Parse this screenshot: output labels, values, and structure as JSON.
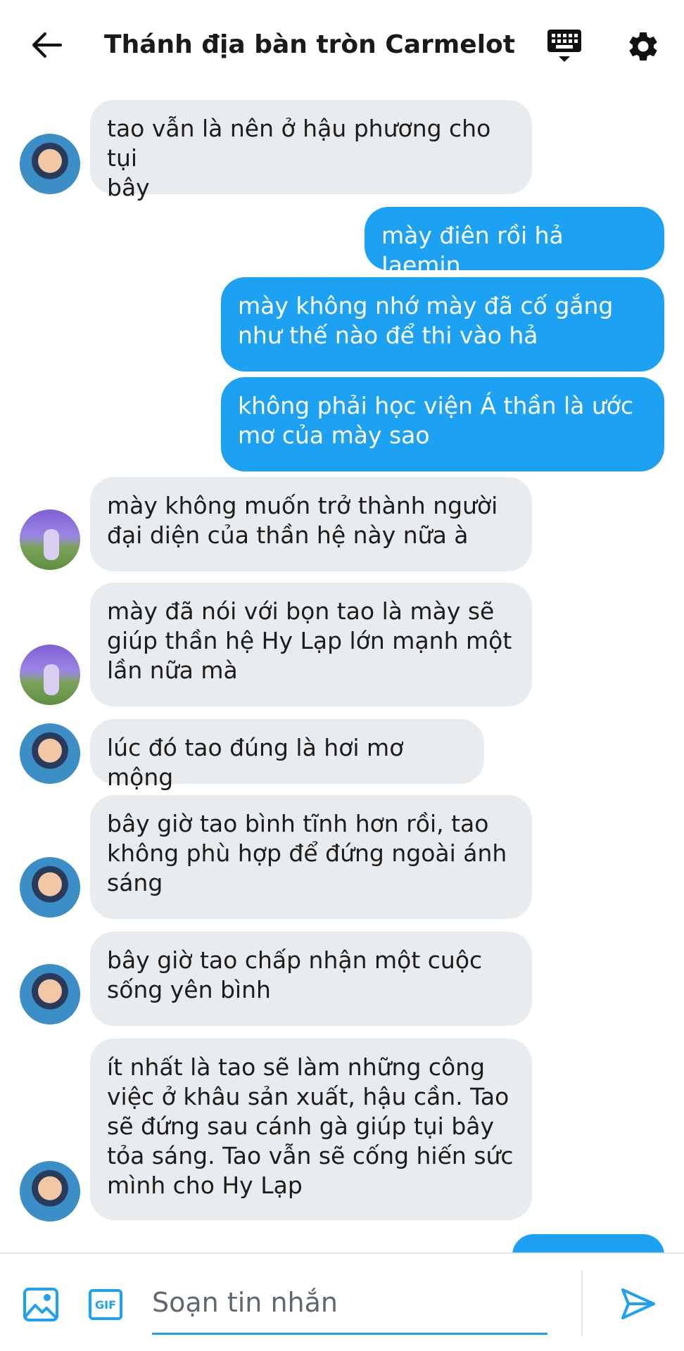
{
  "header": {
    "title": "Thánh địa bàn tròn Carmelot",
    "back_icon": "arrow-left-icon",
    "keyboard_icon": "keyboard-icon",
    "settings_icon": "gear-icon"
  },
  "colors": {
    "accent": "#1da1f2",
    "incoming_bubble": "#e9ecef",
    "outgoing_bubble": "#1da1f2"
  },
  "messages": [
    {
      "direction": "in",
      "avatar": "user-a",
      "text": "tao vẫn là nên ở hậu phương cho tụi\nbây"
    },
    {
      "direction": "out",
      "text": "mày điên rồi hả Jaemin"
    },
    {
      "direction": "out",
      "text": "mày không nhớ mày đã cố gắng\nnhư thế nào để thi vào hả"
    },
    {
      "direction": "out",
      "text": "không phải học viện Á thần là ước\nmơ của mày sao"
    },
    {
      "direction": "in",
      "avatar": "user-b",
      "text": "mày không muốn trở thành người\nđại diện của thần hệ này nữa à"
    },
    {
      "direction": "in",
      "avatar": "user-b",
      "text": "mày đã nói với bọn tao là mày sẽ\ngiúp thần hệ Hy Lạp lớn mạnh một\nlần nữa mà"
    },
    {
      "direction": "in",
      "avatar": "user-a",
      "text": "lúc đó tao đúng là hơi mơ mộng"
    },
    {
      "direction": "in",
      "avatar": "user-a",
      "text": "bây giờ tao bình tĩnh hơn rồi, tao\nkhông phù hợp để đứng ngoài ánh\nsáng"
    },
    {
      "direction": "in",
      "avatar": "user-a",
      "text": "bây giờ tao chấp nhận một cuộc\nsống yên bình"
    },
    {
      "direction": "in",
      "avatar": "user-a",
      "text": "ít nhất là tao sẽ làm những công\nviệc ở khâu sản xuất, hậu cần. Tao\nsẽ đứng sau cánh gà giúp tụi bây\ntỏa sáng. Tao vẫn sẽ cống hiến sức\nmình cho Hy Lạp"
    }
  ],
  "composer": {
    "placeholder": "Soạn tin nhắn",
    "value": "",
    "gif_label": "GIF",
    "image_icon": "image-icon",
    "send_icon": "send-icon"
  }
}
